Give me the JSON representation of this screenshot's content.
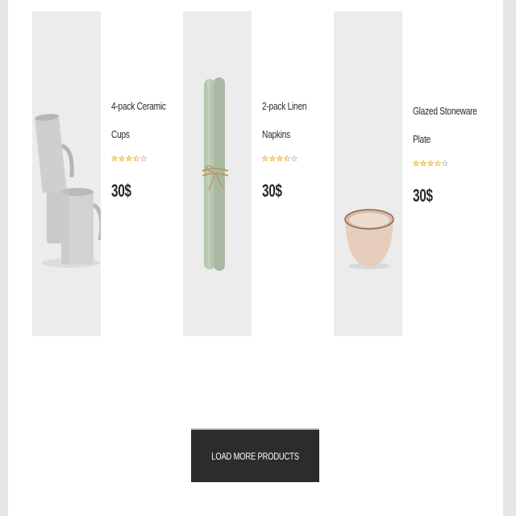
{
  "products": [
    {
      "name_line1": "4-pack Ceramic",
      "name_line2": "Cups",
      "rating": 3.5,
      "rating_max": 5,
      "price": "30$",
      "image_icon": "ceramic-mugs-image"
    },
    {
      "name_line1": "2-pack Linen",
      "name_line2": "Napkins",
      "rating": 3.5,
      "rating_max": 5,
      "price": "30$",
      "image_icon": "rolled-napkins-image"
    },
    {
      "name_line1": "Glazed Stoneware",
      "name_line2": "Plate",
      "rating": 3.5,
      "rating_max": 5,
      "price": "30$",
      "image_icon": "stoneware-bowl-image"
    }
  ],
  "load_more": {
    "label": "LOAD MORE PRODUCTS"
  },
  "colors": {
    "star_filled": "#f2b33d",
    "star_empty": "#bdbdbd",
    "button_bg": "#2b2c2e",
    "thumb_bg": "#ececec"
  }
}
